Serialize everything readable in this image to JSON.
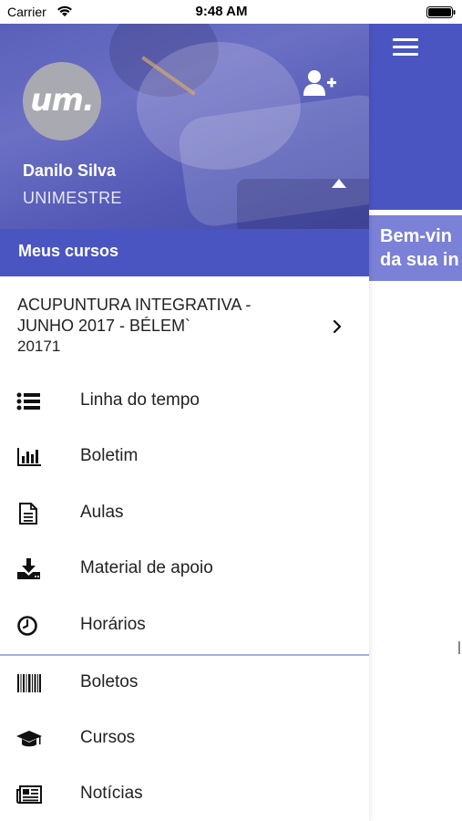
{
  "status_bar": {
    "carrier": "Carrier",
    "time": "9:48 AM"
  },
  "background_app": {
    "banner_line1": "Bem-vin",
    "banner_line2": "da sua in"
  },
  "profile": {
    "avatar_logo": "um.",
    "name": "Danilo Silva",
    "organization": "UNIMESTRE"
  },
  "section": {
    "title": "Meus cursos"
  },
  "course": {
    "name": "ACUPUNTURA INTEGRATIVA - JUNHO 2017 - BÉLEM`",
    "code": "20171"
  },
  "menu": [
    {
      "label": "Linha do tempo",
      "icon": "list-icon"
    },
    {
      "label": "Boletim",
      "icon": "bar-chart-icon"
    },
    {
      "label": "Aulas",
      "icon": "document-icon"
    },
    {
      "label": "Material de apoio",
      "icon": "download-icon"
    },
    {
      "label": "Horários",
      "icon": "clock-icon"
    },
    {
      "label": "Boletos",
      "icon": "barcode-icon"
    },
    {
      "label": "Cursos",
      "icon": "graduation-cap-icon"
    },
    {
      "label": "Notícias",
      "icon": "newspaper-icon"
    }
  ],
  "colors": {
    "primary": "#4a55c2",
    "banner": "#7b81d6",
    "divider": "#a8acdf",
    "text": "#222222"
  }
}
